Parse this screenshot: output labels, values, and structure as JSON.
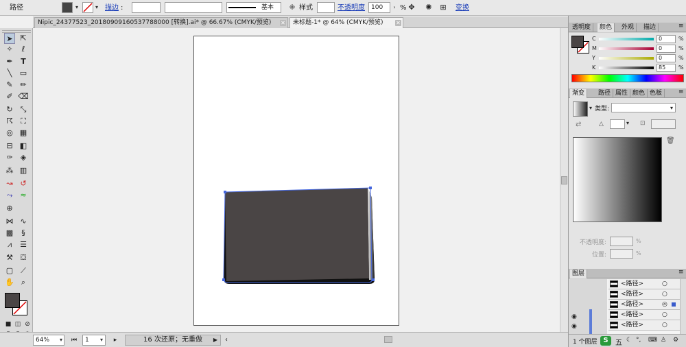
{
  "control_bar": {
    "object_label": "路径",
    "stroke_label": "描边",
    "stroke_profile_label": "基本",
    "style_label": "样式",
    "opacity_label": "不透明度",
    "opacity_value": "100",
    "opacity_unit": "%",
    "transform_label": "变换"
  },
  "tabs": [
    {
      "label": "Nipic_24377523_20180909160537788000 [转换].ai* @ 66.67% (CMYK/预览)",
      "active": false
    },
    {
      "label": "未标题-1* @ 64% (CMYK/预览)",
      "active": true
    }
  ],
  "statusbar": {
    "zoom": "64%",
    "page": "1",
    "message": "16 次还原；无重做"
  },
  "color_panel": {
    "tabs": [
      "透明度",
      "颜色",
      "外观",
      "描边"
    ],
    "active_tab": "颜色",
    "channels": [
      {
        "name": "C",
        "value": "0"
      },
      {
        "name": "M",
        "value": "0"
      },
      {
        "name": "Y",
        "value": "0"
      },
      {
        "name": "K",
        "value": "85"
      }
    ],
    "unit": "%",
    "fill_color": "#4a4545"
  },
  "gradient_panel": {
    "tabs": [
      "渐变",
      "路径",
      "属性",
      "颜色",
      "色板"
    ],
    "active_tab": "渐变",
    "type_label": "类型:",
    "opacity_label": "不透明度:",
    "position_label": "位置:",
    "unit": "%"
  },
  "layers_panel": {
    "tab": "图层",
    "rows": [
      "<路径>",
      "<路径>",
      "<路径>",
      "<路径>",
      "<路径>"
    ],
    "footer": "1 个图层",
    "ime_badge": "五"
  },
  "artwork": {
    "shape_fill": "#4a4545",
    "outline_color": "#4466dd"
  }
}
